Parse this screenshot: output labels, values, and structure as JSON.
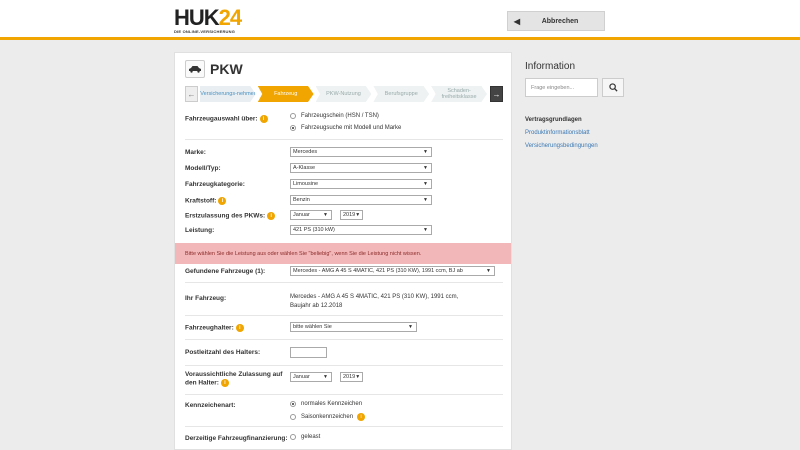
{
  "header": {
    "logo_main": "HUK",
    "logo_num": "24",
    "logo_sub": "DIE ONLINE-VERSICHERUNG",
    "cancel_label": "Abbrechen"
  },
  "page": {
    "title": "PKW"
  },
  "steps": [
    {
      "label": "Versicherungs-nehmer",
      "state": "done"
    },
    {
      "label": "Fahrzeug",
      "state": "active"
    },
    {
      "label": "PKW-Nutzung",
      "state": "pending"
    },
    {
      "label": "Berufsgruppe",
      "state": "pending"
    },
    {
      "label": "Schaden-freiheitsklasse",
      "state": "pending"
    }
  ],
  "form": {
    "auswahl_label": "Fahrzeugauswahl über:",
    "auswahl_options": [
      "Fahrzeugschein (HSN / TSN)",
      "Fahrzeugsuche mit Modell und Marke"
    ],
    "marke_label": "Marke:",
    "marke_value": "Mercedes",
    "modell_label": "Modell/Typ:",
    "modell_value": "A-Klasse",
    "kategorie_label": "Fahrzeugkategorie:",
    "kategorie_value": "Limousine",
    "kraftstoff_label": "Kraftstoff:",
    "kraftstoff_value": "Benzin",
    "erstzulassung_label": "Erstzulassung des PKWs:",
    "erstzulassung_month": "Januar",
    "erstzulassung_year": "2019",
    "leistung_label": "Leistung:",
    "leistung_value": "421 PS (310 kW)",
    "error_text": "Bitte wählen Sie die Leistung aus oder wählen Sie \"beliebig\", wenn Sie die Leistung nicht wissen.",
    "gefunden_label": "Gefundene Fahrzeuge (1):",
    "gefunden_value": "Mercedes - AMG A 45 S 4MATIC, 421 PS (310 KW), 1991 ccm, BJ ab",
    "ihr_label": "Ihr Fahrzeug:",
    "ihr_value_line1": "Mercedes - AMG A 45 S 4MATIC, 421 PS (310 KW), 1991 ccm,",
    "ihr_value_line2": "Baujahr ab 12.2018",
    "halter_label": "Fahrzeughalter:",
    "halter_value": "bitte wählen Sie",
    "plz_label": "Postleitzahl des Halters:",
    "zulassung_label": "Voraussichtliche Zulassung auf den Halter:",
    "zulassung_month": "Januar",
    "zulassung_year": "2019",
    "kennzeichen_label": "Kennzeichenart:",
    "kennzeichen_options": [
      "normales Kennzeichen",
      "Saisonkennzeichen"
    ],
    "finanzierung_label": "Derzeitige Fahrzeugfinanzierung:",
    "finanzierung_options": [
      "geleast"
    ]
  },
  "sidebar": {
    "title": "Information",
    "search_placeholder": "Frage eingeben...",
    "section_title": "Vertragsgrundlagen",
    "links": [
      "Produktinformationsblatt",
      "Versicherungsbedingungen"
    ]
  },
  "colors": {
    "accent": "#f0a500",
    "error_bg": "#f2b7b8",
    "link": "#3a78b5"
  }
}
